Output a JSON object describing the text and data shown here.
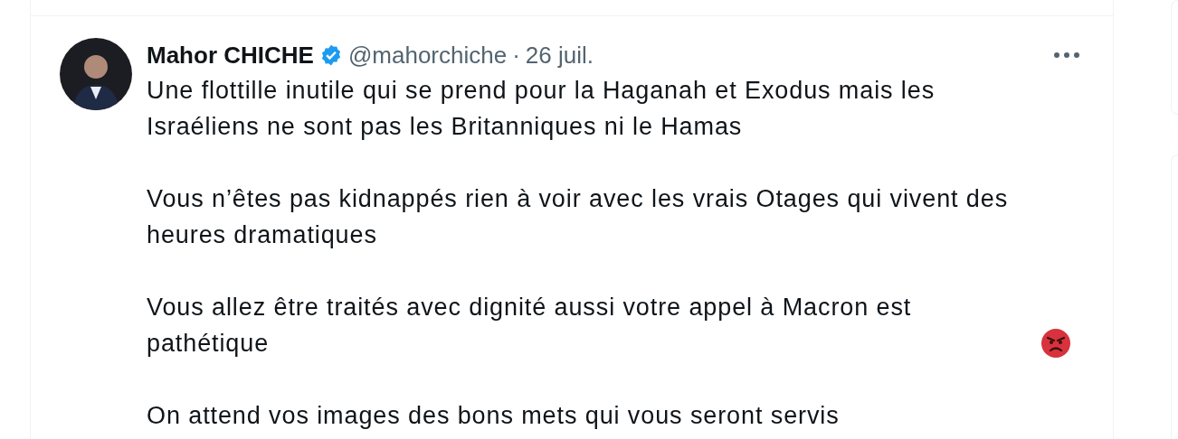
{
  "tweet": {
    "author_name": "Mahor CHICHE",
    "verified": true,
    "handle": "@mahorchiche",
    "separator": "·",
    "date": "26 juil.",
    "paragraphs": [
      {
        "text": "Une flottille inutile qui se prend pour la Haganah et Exodus mais les Israéliens ne sont pas les Britanniques ni le Hamas",
        "trailing_emoji": false
      },
      {
        "text": "Vous n’êtes pas kidnappés rien à voir avec les vrais Otages qui vivent des heures dramatiques",
        "trailing_emoji": false
      },
      {
        "text": "Vous allez être traités avec dignité aussi votre appel à Macron est pathétique",
        "trailing_emoji": true
      },
      {
        "text": "On attend vos images des bons mets qui vous seront servis",
        "trailing_emoji": false
      }
    ]
  }
}
